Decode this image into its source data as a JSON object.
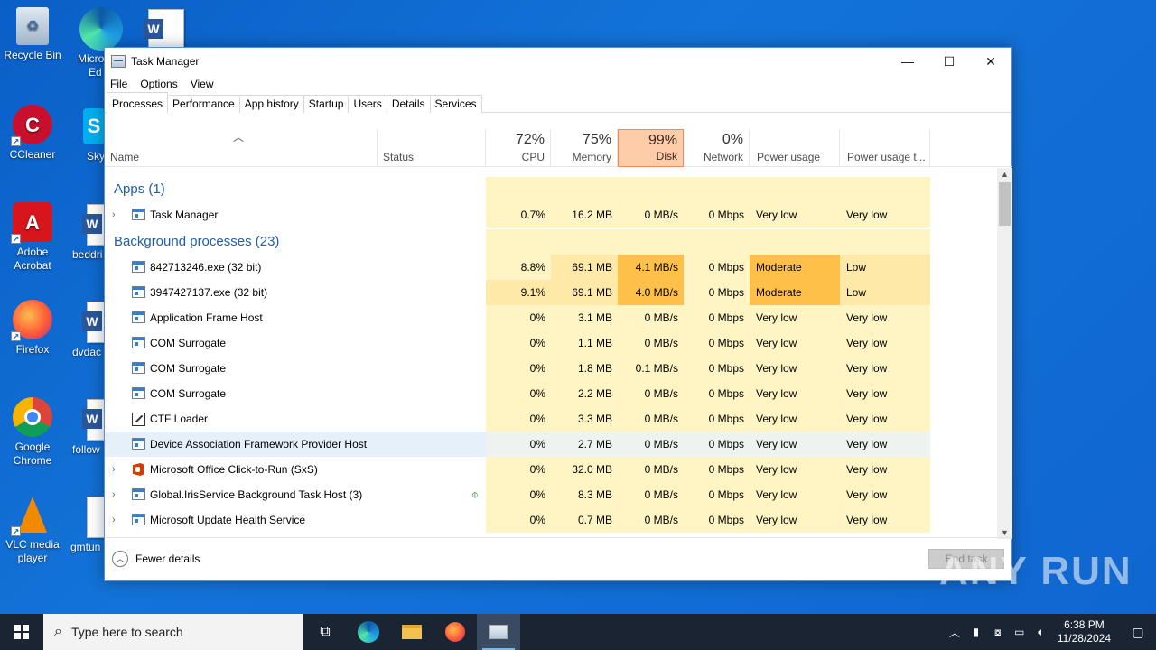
{
  "desktop": {
    "icons": [
      {
        "label": "Recycle Bin"
      },
      {
        "label": "CCleaner"
      },
      {
        "label": "Adobe Acrobat"
      },
      {
        "label": "Firefox"
      },
      {
        "label": "Google Chrome"
      },
      {
        "label": "VLC media player"
      }
    ],
    "partial_labels": [
      "Micro",
      "Ed",
      "Sky",
      "beddri",
      "dvdac",
      "follow",
      "gmtun"
    ]
  },
  "window": {
    "title": "Task Manager",
    "minimize": "—",
    "maximize": "☐",
    "close": "✕"
  },
  "menu": [
    "File",
    "Options",
    "View"
  ],
  "tabs": [
    "Processes",
    "Performance",
    "App history",
    "Startup",
    "Users",
    "Details",
    "Services"
  ],
  "header": {
    "name": "Name",
    "status": "Status",
    "cpu": {
      "pct": "72%",
      "label": "CPU"
    },
    "memory": {
      "pct": "75%",
      "label": "Memory"
    },
    "disk": {
      "pct": "99%",
      "label": "Disk"
    },
    "network": {
      "pct": "0%",
      "label": "Network"
    },
    "power": "Power usage",
    "power_trend": "Power usage t..."
  },
  "groups": {
    "apps": "Apps (1)",
    "background": "Background processes (23)"
  },
  "apps": [
    {
      "name": "Task Manager",
      "cpu": "0.7%",
      "mem": "16.2 MB",
      "disk": "0 MB/s",
      "net": "0 Mbps",
      "power": "Very low",
      "powert": "Very low"
    }
  ],
  "processes": [
    {
      "name": "842713246.exe (32 bit)",
      "cpu": "8.8%",
      "mem": "69.1 MB",
      "disk": "4.1 MB/s",
      "net": "0 Mbps",
      "power": "Moderate",
      "powert": "Low"
    },
    {
      "name": "3947427137.exe (32 bit)",
      "cpu": "9.1%",
      "mem": "69.1 MB",
      "disk": "4.0 MB/s",
      "net": "0 Mbps",
      "power": "Moderate",
      "powert": "Low"
    },
    {
      "name": "Application Frame Host",
      "cpu": "0%",
      "mem": "3.1 MB",
      "disk": "0 MB/s",
      "net": "0 Mbps",
      "power": "Very low",
      "powert": "Very low"
    },
    {
      "name": "COM Surrogate",
      "cpu": "0%",
      "mem": "1.1 MB",
      "disk": "0 MB/s",
      "net": "0 Mbps",
      "power": "Very low",
      "powert": "Very low"
    },
    {
      "name": "COM Surrogate",
      "cpu": "0%",
      "mem": "1.8 MB",
      "disk": "0.1 MB/s",
      "net": "0 Mbps",
      "power": "Very low",
      "powert": "Very low"
    },
    {
      "name": "COM Surrogate",
      "cpu": "0%",
      "mem": "2.2 MB",
      "disk": "0 MB/s",
      "net": "0 Mbps",
      "power": "Very low",
      "powert": "Very low"
    },
    {
      "name": "CTF Loader",
      "cpu": "0%",
      "mem": "3.3 MB",
      "disk": "0 MB/s",
      "net": "0 Mbps",
      "power": "Very low",
      "powert": "Very low"
    },
    {
      "name": "Device Association Framework Provider Host",
      "cpu": "0%",
      "mem": "2.7 MB",
      "disk": "0 MB/s",
      "net": "0 Mbps",
      "power": "Very low",
      "powert": "Very low"
    },
    {
      "name": "Microsoft Office Click-to-Run (SxS)",
      "cpu": "0%",
      "mem": "32.0 MB",
      "disk": "0 MB/s",
      "net": "0 Mbps",
      "power": "Very low",
      "powert": "Very low"
    },
    {
      "name": "Global.IrisService Background Task Host (3)",
      "cpu": "0%",
      "mem": "8.3 MB",
      "disk": "0 MB/s",
      "net": "0 Mbps",
      "power": "Very low",
      "powert": "Very low"
    },
    {
      "name": "Microsoft Update Health Service",
      "cpu": "0%",
      "mem": "0.7 MB",
      "disk": "0 MB/s",
      "net": "0 Mbps",
      "power": "Very low",
      "powert": "Very low"
    }
  ],
  "footer": {
    "fewer_details": "Fewer details",
    "end_task": "End task"
  },
  "taskbar": {
    "search_placeholder": "Type here to search",
    "time": "6:38 PM",
    "date": "11/28/2024"
  },
  "watermark": "ANY RUN"
}
